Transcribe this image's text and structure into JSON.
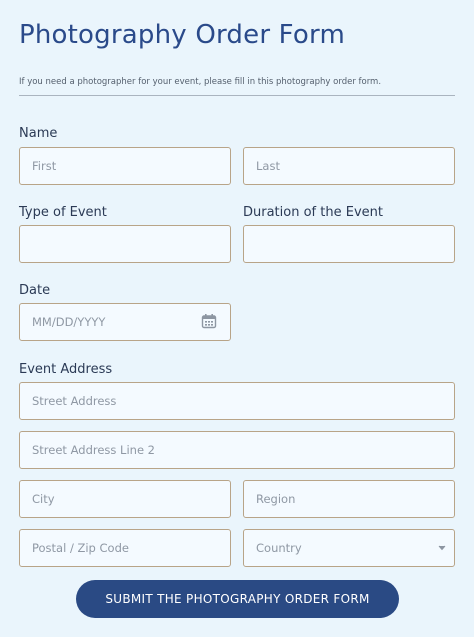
{
  "form": {
    "title": "Photography Order Form",
    "description": "If you need a photographer for your event, please fill in this photography order form."
  },
  "name": {
    "label": "Name",
    "first_placeholder": "First",
    "last_placeholder": "Last"
  },
  "type_of_event": {
    "label": "Type of Event",
    "value": ""
  },
  "duration": {
    "label": "Duration of the Event",
    "value": ""
  },
  "date": {
    "label": "Date",
    "placeholder": "MM/DD/YYYY",
    "icon": "calendar-icon"
  },
  "address": {
    "label": "Event Address",
    "street_placeholder": "Street Address",
    "street2_placeholder": "Street Address Line 2",
    "city_placeholder": "City",
    "region_placeholder": "Region",
    "postal_placeholder": "Postal / Zip Code",
    "country_placeholder": "Country",
    "country_icon": "chevron-down-icon"
  },
  "submit": {
    "label": "SUBMIT THE PHOTOGRAPHY ORDER FORM"
  },
  "colors": {
    "background": "#eaf5fc",
    "title": "#2a4a8a",
    "field_border": "#b8a488",
    "button": "#2a4a84"
  }
}
